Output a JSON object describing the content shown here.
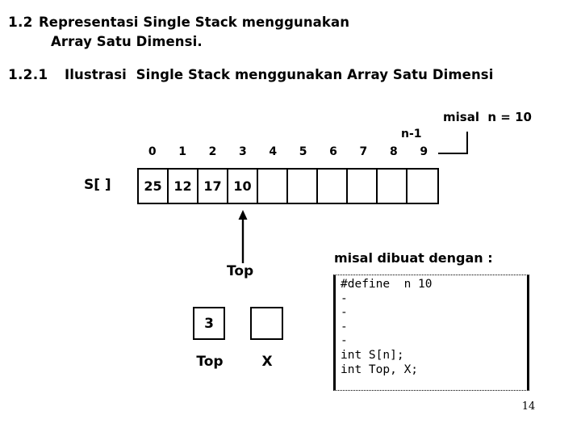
{
  "slide": {
    "page_number": "14",
    "section": {
      "number": "1.2",
      "title_line1": "Representasi Single Stack menggunakan",
      "title_line2": "Array Satu Dimensi."
    },
    "subsection": {
      "number": "1.2.1",
      "title": "Ilustrasi  Single Stack menggunakan Array Satu Dimensi"
    },
    "array_diagram": {
      "name_label": "S[ ]",
      "index_labels": [
        "0",
        "1",
        "2",
        "3",
        "4",
        "5",
        "6",
        "7",
        "8",
        "9"
      ],
      "cells": [
        "25",
        "12",
        "17",
        "10",
        "",
        "",
        "",
        "",
        "",
        ""
      ],
      "last_index_label": "n-1",
      "capacity_note": "misal  n = 10",
      "pointer_label": "Top",
      "pointer_target_index": 3
    },
    "variables": [
      {
        "box_value": "3",
        "caption": "Top"
      },
      {
        "box_value": "",
        "caption": "X"
      }
    ],
    "code_block": {
      "caption": "misal dibuat dengan :",
      "text": "#define  n 10\n-\n-\n-\n-\nint S[n];\nint Top, X;"
    }
  }
}
